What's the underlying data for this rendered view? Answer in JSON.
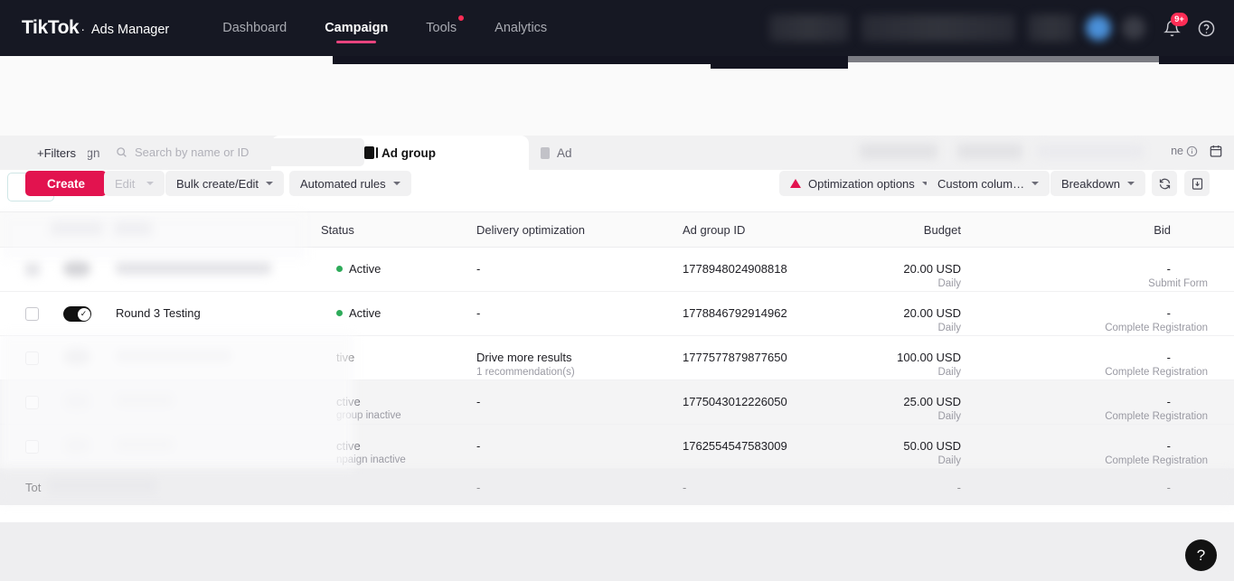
{
  "header": {
    "logo": "TikTok",
    "logo_sub": "Ads Manager",
    "nav": [
      {
        "label": "Dashboard",
        "active": false,
        "dot": false
      },
      {
        "label": "Campaign",
        "active": true,
        "dot": false
      },
      {
        "label": "Tools",
        "active": false,
        "dot": true
      },
      {
        "label": "Analytics",
        "active": false,
        "dot": false
      }
    ],
    "notification_badge": "9+",
    "notification_icon": "bell-icon",
    "help_icon": "question-circle-icon"
  },
  "filterbar": {
    "filters_label": "+Filters",
    "search_placeholder": "Search by name or ID",
    "search_value": "",
    "search_icon": "search-icon",
    "daterange_tail": "ne",
    "info_icon": "info-icon",
    "calendar_icon": "calendar-icon"
  },
  "tabs": [
    {
      "label": "Campaign",
      "icon": "folder-icon",
      "active": false
    },
    {
      "label": "Ad group",
      "icon": "adgroup-icon",
      "active": true
    },
    {
      "label": "Ad",
      "icon": "ad-icon",
      "active": false
    }
  ],
  "toolbar": {
    "create_label": "Create",
    "edit_label": "Edit",
    "bulk_label": "Bulk create/Edit",
    "automated_label": "Automated rules",
    "optimization_label": "Optimization options",
    "custom_columns_label": "Custom colum…",
    "breakdown_label": "Breakdown",
    "refresh_icon": "refresh-icon",
    "export_icon": "export-icon",
    "warning_icon": "warning-triangle-icon"
  },
  "table": {
    "columns": [
      {
        "key": "status",
        "label": "Status"
      },
      {
        "key": "delivery",
        "label": "Delivery optimization"
      },
      {
        "key": "adgroup_id",
        "label": "Ad group ID"
      },
      {
        "key": "budget",
        "label": "Budget"
      },
      {
        "key": "bid",
        "label": "Bid"
      }
    ],
    "rows": [
      {
        "name": "",
        "redacted": true,
        "status": "Active",
        "status_sub": "",
        "delivery": "-",
        "delivery_sub": "",
        "adgroup_id": "1778948024908818",
        "budget": "20.00 USD",
        "budget_sub": "Daily",
        "bid": "-",
        "bid_sub": "Submit Form"
      },
      {
        "name": "Round 3 Testing",
        "redacted": false,
        "status": "Active",
        "status_sub": "",
        "delivery": "-",
        "delivery_sub": "",
        "adgroup_id": "1778846792914962",
        "budget": "20.00 USD",
        "budget_sub": "Daily",
        "bid": "-",
        "bid_sub": "Complete Registration"
      },
      {
        "name": "",
        "redacted": true,
        "status": "tive",
        "status_sub": "",
        "delivery": "Drive more results",
        "delivery_sub": "1 recommendation(s)",
        "adgroup_id": "1777577879877650",
        "budget": "100.00 USD",
        "budget_sub": "Daily",
        "bid": "-",
        "bid_sub": "Complete Registration"
      },
      {
        "name": "",
        "redacted": true,
        "status": "ctive",
        "status_sub": "group inactive",
        "delivery": "-",
        "delivery_sub": "",
        "adgroup_id": "1775043012226050",
        "budget": "25.00 USD",
        "budget_sub": "Daily",
        "bid": "-",
        "bid_sub": "Complete Registration"
      },
      {
        "name": "",
        "redacted": true,
        "status": "ctive",
        "status_sub": "npaign inactive",
        "delivery": "-",
        "delivery_sub": "",
        "adgroup_id": "1762554547583009",
        "budget": "50.00 USD",
        "budget_sub": "Daily",
        "bid": "-",
        "bid_sub": "Complete Registration"
      }
    ],
    "total": {
      "label": "Tot",
      "delivery": "-",
      "adgroup_id": "-",
      "budget": "-",
      "bid": "-"
    }
  },
  "fab": {
    "icon": "question-circle-icon",
    "glyph": "?"
  },
  "colors": {
    "brand_pink": "#e2134f",
    "nav_accent": "#e8447e",
    "header_bg": "#161823",
    "status_green": "#2eab5a",
    "warning_red": "#e2134f"
  }
}
